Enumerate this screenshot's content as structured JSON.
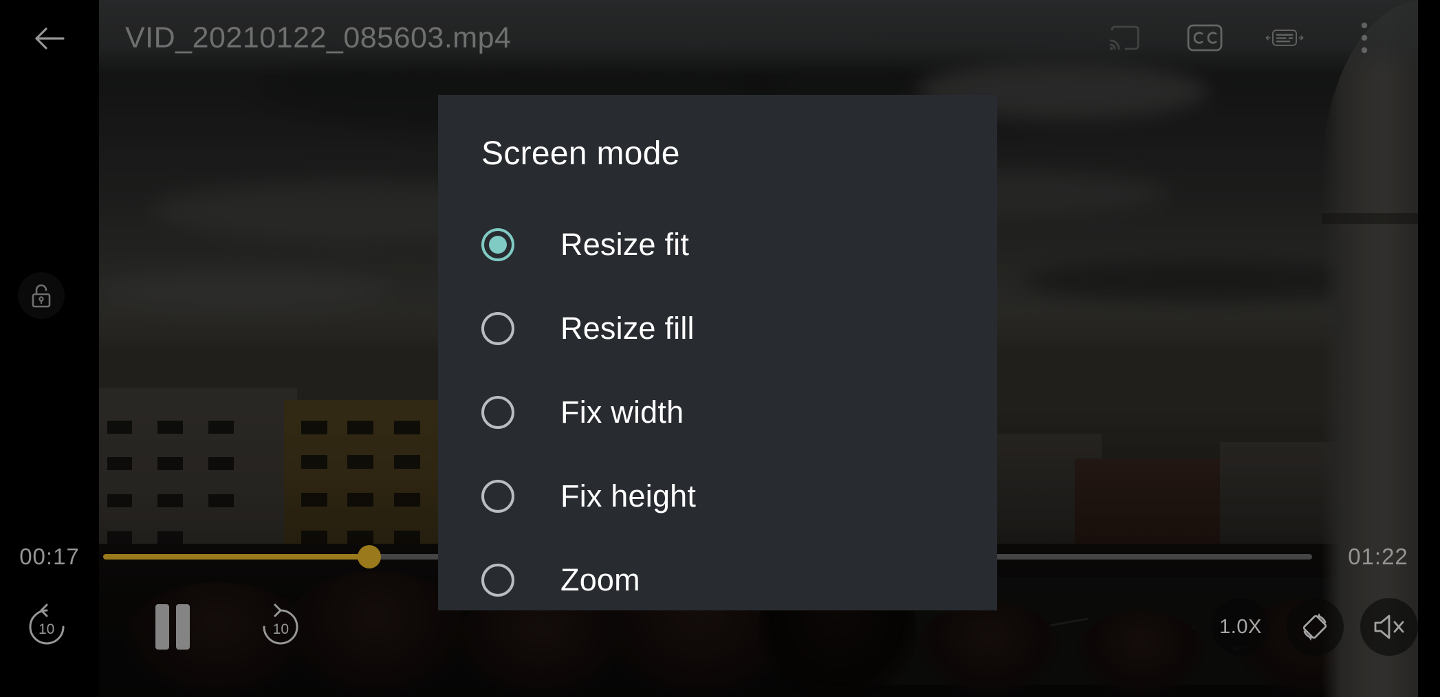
{
  "player": {
    "title": "VID_20210122_085603.mp4",
    "back_icon": "arrow-left-icon",
    "top_actions": [
      {
        "name": "cast-icon",
        "label": "Cast"
      },
      {
        "name": "closed-caption-icon",
        "label": "CC"
      },
      {
        "name": "subtitle-sync-icon",
        "label": "Subtitle sync"
      },
      {
        "name": "overflow-menu-icon",
        "label": "More options"
      }
    ],
    "lock": {
      "icon": "unlock-icon",
      "label": "Unlock screen"
    },
    "seek": {
      "current_time": "00:17",
      "total_time": "01:22",
      "progress_percent": 22,
      "track_color": "#d6a828",
      "thumb_color": "#d6a828"
    },
    "controls": {
      "rewind_label": "10",
      "rewind_icon": "replay-10-icon",
      "play_pause_icon": "pause-icon",
      "forward_label": "10",
      "forward_icon": "forward-10-icon",
      "speed_label": "1.0X",
      "rotate_icon": "screen-rotation-icon",
      "mute_icon": "volume-mute-icon"
    }
  },
  "dialog": {
    "title": "Screen mode",
    "accent_color": "#80cbc4",
    "background_color": "#282b30",
    "selected_index": 0,
    "options": [
      {
        "label": "Resize fit",
        "selected": true
      },
      {
        "label": "Resize fill",
        "selected": false
      },
      {
        "label": "Fix width",
        "selected": false
      },
      {
        "label": "Fix height",
        "selected": false
      },
      {
        "label": "Zoom",
        "selected": false
      }
    ]
  }
}
